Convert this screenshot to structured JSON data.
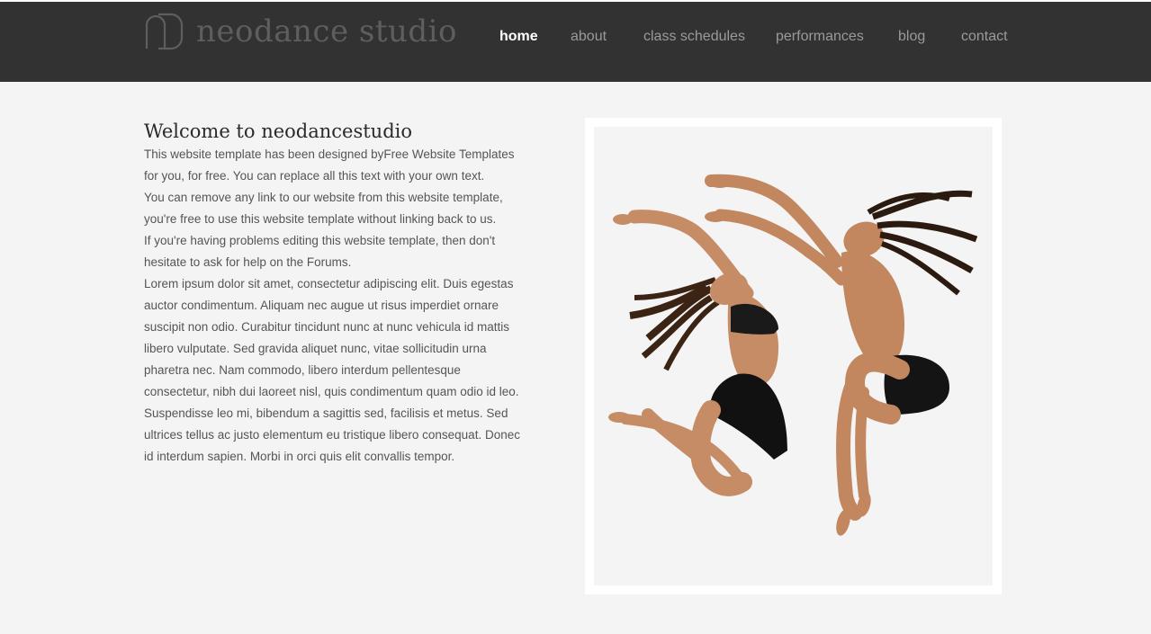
{
  "header": {
    "logo_text": "neodance studio",
    "nav": [
      {
        "label": "home",
        "active": true
      },
      {
        "label": "about",
        "active": false
      },
      {
        "label": "class schedules",
        "active": false
      },
      {
        "label": "performances",
        "active": false
      },
      {
        "label": "blog",
        "active": false
      },
      {
        "label": "contact",
        "active": false
      }
    ]
  },
  "main": {
    "title": "Welcome to neodancestudio",
    "lines": [
      "This website template has been designed byFree Website Templates",
      "for you, for free. You can replace all this text with your own text.",
      "You can remove any link to our website from this website template,",
      "you're free to use this website template without linking back to us.",
      "If you're having problems editing this website template, then don't",
      "hesitate to ask for help on the Forums.",
      "Lorem ipsum dolor sit amet, consectetur adipiscing elit. Duis egestas",
      "auctor condimentum. Aliquam nec augue ut risus imperdiet ornare",
      "suscipit non odio. Curabitur tincidunt nunc at nunc vehicula id mattis",
      "libero vulputate. Sed gravida aliquet nunc, vitae sollicitudin urna",
      "pharetra nec. Nam commodo, libero interdum pellentesque",
      "consectetur, nibh dui laoreet nisl, quis condimentum quam odio id leo.",
      "Suspendisse leo mi, bibendum a sagittis sed, facilisis et metus. Sed",
      "ultrices tellus ac justo elementum eu tristique libero consequat. Donec",
      "id interdum sapien. Morbi in orci quis elit convallis tempor."
    ]
  },
  "colors": {
    "header_bg": "#323232",
    "page_bg": "#f4f4f4",
    "nav_active": "#ffffff",
    "nav_inactive": "#9a9a9a"
  }
}
